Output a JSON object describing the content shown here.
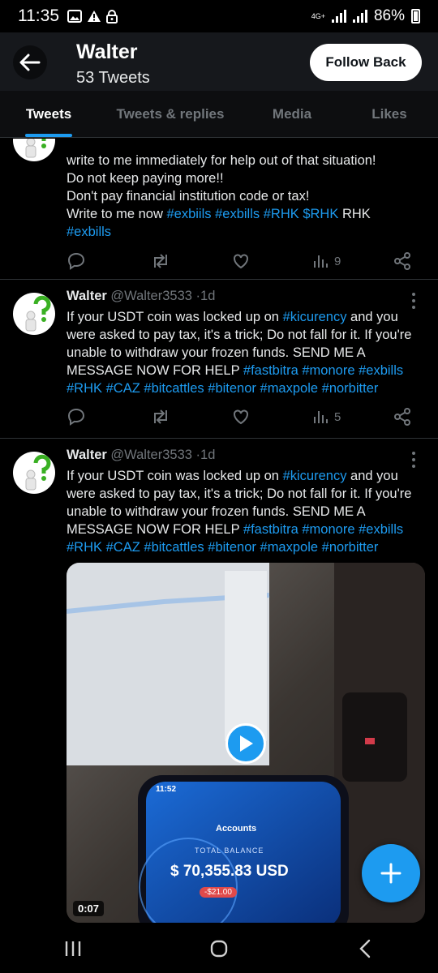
{
  "status_bar": {
    "time": "11:35",
    "network_label": "4G+",
    "battery": "86%"
  },
  "header": {
    "name": "Walter",
    "tweet_count": "53 Tweets",
    "follow_back_label": "Follow Back"
  },
  "tabs": [
    {
      "label": "Tweets",
      "active": true
    },
    {
      "label": "Tweets & replies",
      "active": false
    },
    {
      "label": "Media",
      "active": false
    },
    {
      "label": "Likes",
      "active": false
    }
  ],
  "tweets": [
    {
      "lines": [
        [
          {
            "t": "write to me immediately for help out of that situation!"
          }
        ],
        [
          {
            "t": "Do not keep paying more!!"
          }
        ],
        [
          {
            "t": "Don't pay financial institution code or tax!"
          }
        ],
        [
          {
            "t": "Write to me now "
          },
          {
            "t": "#exbiils",
            "h": true
          },
          {
            "t": " "
          },
          {
            "t": "#exbills",
            "h": true
          },
          {
            "t": " "
          },
          {
            "t": "#RHK",
            "h": true
          },
          {
            "t": " "
          },
          {
            "t": "$RHK",
            "h": true
          },
          {
            "t": " RHK"
          }
        ],
        [
          {
            "t": "#exbills",
            "h": true
          }
        ]
      ],
      "views": "9"
    },
    {
      "name": "Walter",
      "handle": "@Walter3533",
      "age": "1d",
      "lines": [
        [
          {
            "t": "If your USDT coin was locked up on "
          },
          {
            "t": "#kicurency",
            "h": true
          },
          {
            "t": " and you"
          }
        ],
        [
          {
            "t": "were asked to pay tax, it's a trick;  Do not fall for it.  If you're"
          }
        ],
        [
          {
            "t": "unable to withdraw your frozen funds.  SEND ME A"
          }
        ],
        [
          {
            "t": "MESSAGE NOW FOR HELP "
          },
          {
            "t": "#fastbitra",
            "h": true
          },
          {
            "t": " "
          },
          {
            "t": "#monore",
            "h": true
          },
          {
            "t": " "
          },
          {
            "t": "#exbills",
            "h": true
          }
        ],
        [
          {
            "t": "#RHK",
            "h": true
          },
          {
            "t": " "
          },
          {
            "t": "#CAZ",
            "h": true
          },
          {
            "t": " "
          },
          {
            "t": "#bitcattles",
            "h": true
          },
          {
            "t": " "
          },
          {
            "t": "#bitenor",
            "h": true
          },
          {
            "t": " "
          },
          {
            "t": "#maxpole",
            "h": true
          },
          {
            "t": " "
          },
          {
            "t": "#norbitter",
            "h": true
          }
        ]
      ],
      "views": "5"
    },
    {
      "name": "Walter",
      "handle": "@Walter3533",
      "age": "1d",
      "lines": [
        [
          {
            "t": "If your USDT coin was locked up on "
          },
          {
            "t": "#kicurency",
            "h": true
          },
          {
            "t": " and you"
          }
        ],
        [
          {
            "t": "were asked to pay tax, it's a trick;  Do not fall for it.  If you're"
          }
        ],
        [
          {
            "t": "unable to withdraw your frozen funds.  SEND ME A"
          }
        ],
        [
          {
            "t": "MESSAGE NOW FOR HELP "
          },
          {
            "t": "#fastbitra",
            "h": true
          },
          {
            "t": " "
          },
          {
            "t": "#monore",
            "h": true
          },
          {
            "t": " "
          },
          {
            "t": "#exbills",
            "h": true
          }
        ],
        [
          {
            "t": "#RHK",
            "h": true
          },
          {
            "t": " "
          },
          {
            "t": "#CAZ",
            "h": true
          },
          {
            "t": " "
          },
          {
            "t": "#bitcattles",
            "h": true
          },
          {
            "t": " "
          },
          {
            "t": "#bitenor",
            "h": true
          },
          {
            "t": " "
          },
          {
            "t": "#maxpole",
            "h": true
          },
          {
            "t": " "
          },
          {
            "t": "#norbitter",
            "h": true
          }
        ]
      ],
      "video": {
        "duration": "0:07",
        "phone_time": "11:52",
        "phone_title": "Accounts",
        "phone_balance_label": "TOTAL BALANCE",
        "phone_balance": "$ 70,355.83 USD",
        "phone_change": "-$21.00"
      }
    }
  ],
  "icons": {
    "back": "arrow-left-icon",
    "reply": "reply-icon",
    "retweet": "retweet-icon",
    "like": "heart-icon",
    "views": "views-icon",
    "share": "share-icon",
    "more": "more-icon",
    "play": "play-icon",
    "compose": "plus-icon"
  },
  "colors": {
    "accent": "#1d9bf0",
    "background": "#000000",
    "muted": "#71767b",
    "text": "#e7e9ea"
  }
}
